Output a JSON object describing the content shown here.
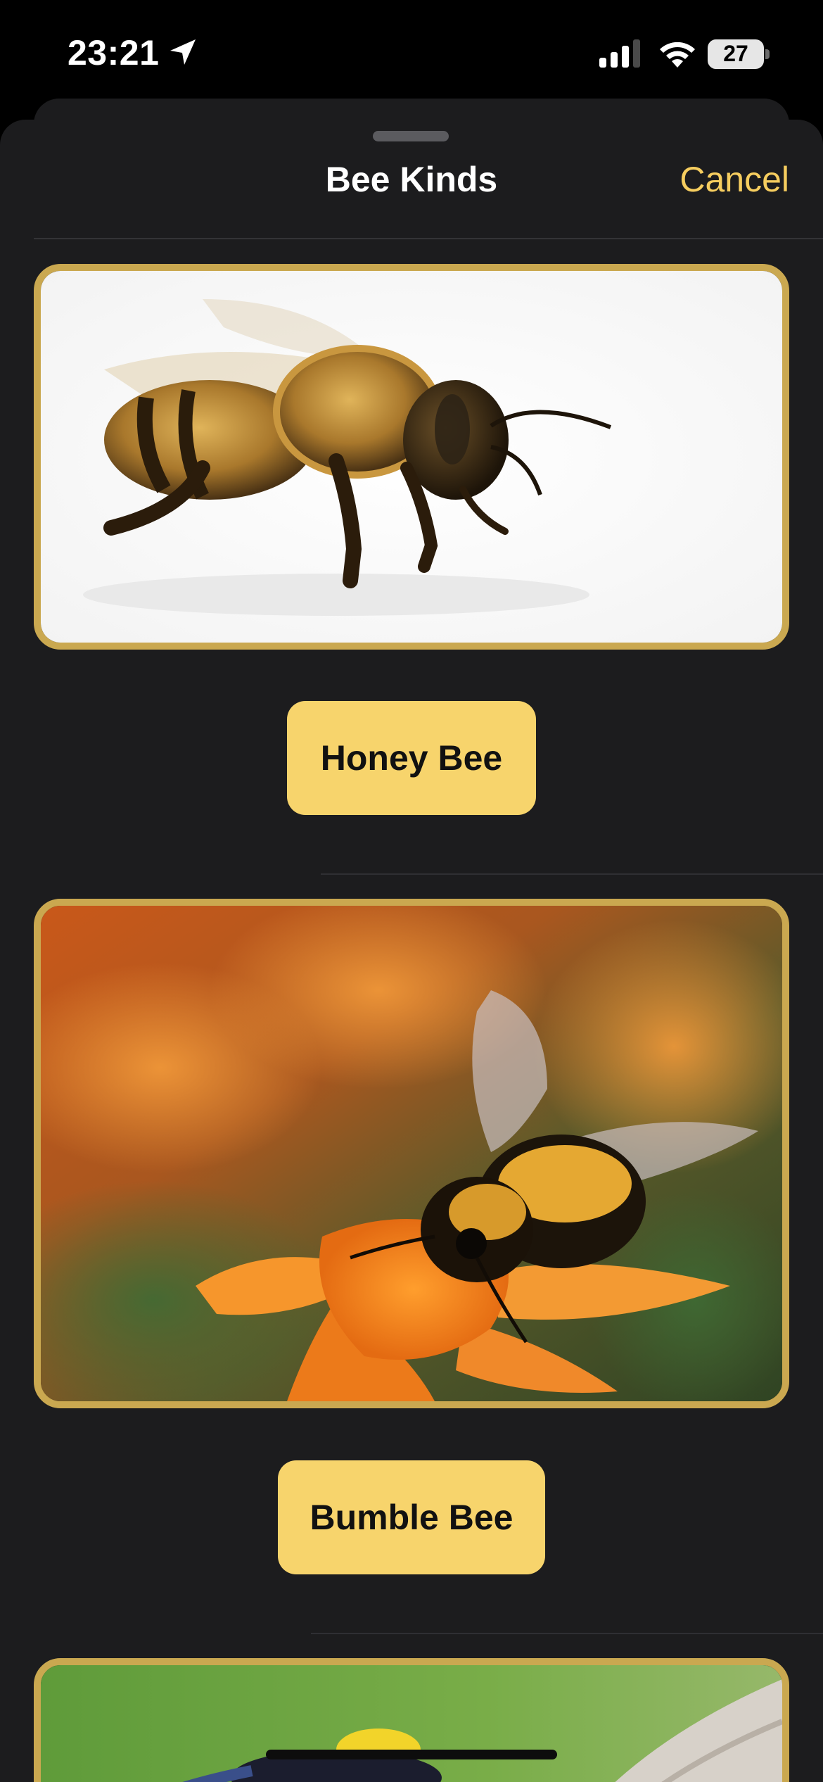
{
  "status_bar": {
    "time": "23:21",
    "battery_percent": "27",
    "location_icon": "location-arrow-icon",
    "signal_icon": "cellular-signal-icon",
    "wifi_icon": "wifi-icon",
    "battery_icon": "battery-icon"
  },
  "sheet": {
    "title": "Bee Kinds",
    "cancel_label": "Cancel",
    "accent_color": "#f6cd5f",
    "card_border_color": "#caa850",
    "button_color": "#f7d46c"
  },
  "items": [
    {
      "label": "Honey Bee"
    },
    {
      "label": "Bumble Bee"
    },
    {
      "label": ""
    }
  ]
}
